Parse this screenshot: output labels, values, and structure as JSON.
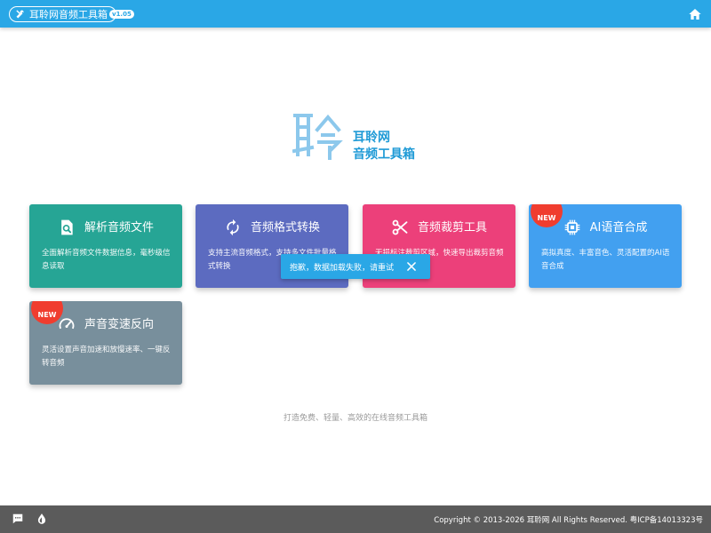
{
  "header": {
    "app_title": "耳聆网音频工具箱",
    "version": "v1.05",
    "home_icon": "home-icon"
  },
  "logo": {
    "glyph": "聆",
    "line1": "耳聆网",
    "line2": "音频工具箱"
  },
  "cards": [
    {
      "icon": "file-search-icon",
      "title": "解析音频文件",
      "desc": "全面解析音频文件数据信息，毫秒级信息读取",
      "new": false
    },
    {
      "icon": "convert-icon",
      "title": "音频格式转换",
      "desc": "支持主流音频格式，支持多文件批量格式转换",
      "new": false
    },
    {
      "icon": "scissors-icon",
      "title": "音频裁剪工具",
      "desc": "无损标注裁剪区域，快速导出裁剪音频",
      "new": false
    },
    {
      "icon": "chip-icon",
      "title": "AI语音合成",
      "desc": "高拟真度、丰富音色、灵活配置的AI语音合成",
      "new": true
    },
    {
      "icon": "speedometer-icon",
      "title": "声音变速反向",
      "desc": "灵活设置声音加速和放慢速率、一键反转音频",
      "new": true
    }
  ],
  "new_label": "NEW",
  "toast": {
    "message": "抱歉，数据加载失败，请重试"
  },
  "tagline": "打造免费、轻量、高效的在线音频工具箱",
  "footer": {
    "copyright": "Copyright © 2013-2026 耳聆网 All Rights Reserved. 粤ICP备14013323号"
  },
  "colors": {
    "primary": "#2aa7e6",
    "card1": "#26a595",
    "card2": "#5c6bc0",
    "card3": "#ec407a",
    "card4": "#42a0f0",
    "card5": "#788f9c",
    "new_badge": "#f03d2f",
    "footer": "#5b5b5b"
  }
}
